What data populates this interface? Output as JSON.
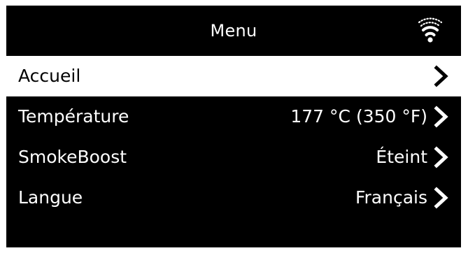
{
  "header": {
    "title": "Menu",
    "wifi_icon": "wifi-icon"
  },
  "menu": {
    "items": [
      {
        "label": "Accueil",
        "value": "",
        "selected": true
      },
      {
        "label": "Température",
        "value": "177 °C (350 °F)",
        "selected": false
      },
      {
        "label": "SmokeBoost",
        "value": "Éteint",
        "selected": false
      },
      {
        "label": "Langue",
        "value": "Français",
        "selected": false
      }
    ]
  },
  "colors": {
    "screen_background": "#000000",
    "text": "#ffffff",
    "selected_background": "#ffffff",
    "selected_text": "#000000"
  }
}
